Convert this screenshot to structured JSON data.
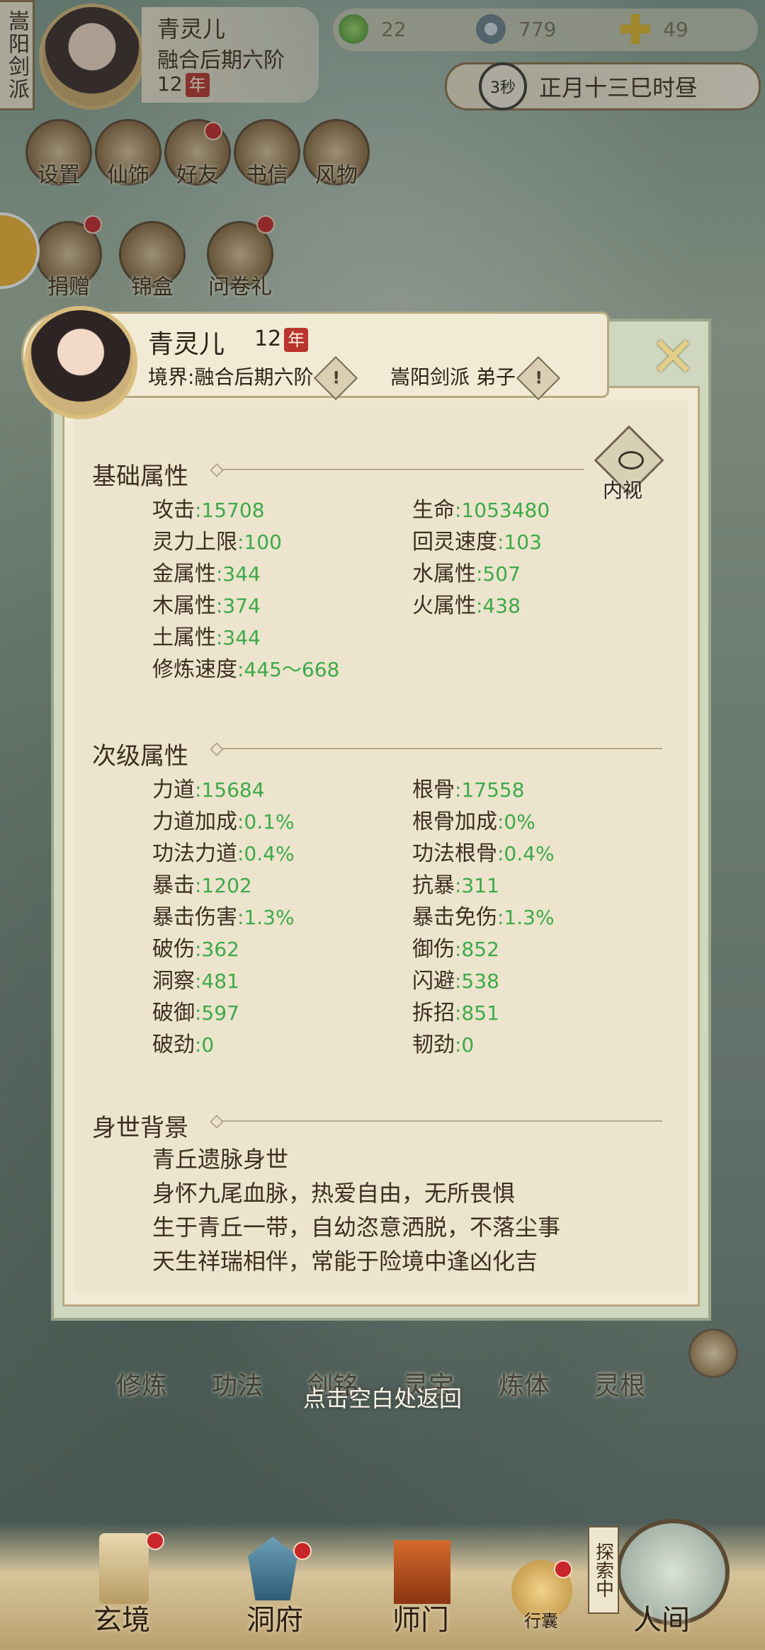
{
  "hud": {
    "sect": "嵩阳剑派",
    "player_name": "青灵儿",
    "realm": "融合后期六阶",
    "age": "12",
    "age_badge": "年",
    "resources": [
      {
        "icon": "jade-leaf-icon",
        "value": "22"
      },
      {
        "icon": "coin-icon",
        "value": "779"
      },
      {
        "icon": "gold-cross-icon",
        "value": "49"
      }
    ],
    "timer": "3秒",
    "game_time": "正月十三巳时昼"
  },
  "menu_row1": [
    {
      "label": "设置",
      "name": "settings",
      "dot": false
    },
    {
      "label": "仙饰",
      "name": "costume",
      "dot": false
    },
    {
      "label": "好友",
      "name": "friends",
      "dot": true
    },
    {
      "label": "书信",
      "name": "letters",
      "dot": false
    },
    {
      "label": "风物",
      "name": "scenery",
      "dot": false
    }
  ],
  "menu_row2": [
    {
      "label": "捐赠",
      "name": "donate",
      "dot": true
    },
    {
      "label": "锦盒",
      "name": "gift-box",
      "dot": false
    },
    {
      "label": "问卷礼",
      "name": "survey-gift",
      "dot": true
    }
  ],
  "panel": {
    "name": "青灵儿",
    "age": "12",
    "age_badge": "年",
    "realm_label": "境界",
    "realm_value": ":融合后期六阶",
    "sect_value": "嵩阳剑派 弟子",
    "warn_glyph": "!",
    "close_glyph": "✕",
    "inner_view_label": "内视",
    "basic_title": "基础属性",
    "basic_stats": [
      {
        "label": "攻击",
        "value": ":15708"
      },
      {
        "label": "生命",
        "value": ":1053480"
      },
      {
        "label": "灵力上限",
        "value": ":100"
      },
      {
        "label": "回灵速度",
        "value": ":103"
      },
      {
        "label": "金属性",
        "value": ":344"
      },
      {
        "label": "水属性",
        "value": ":507"
      },
      {
        "label": "木属性",
        "value": ":374"
      },
      {
        "label": "火属性",
        "value": ":438"
      },
      {
        "label": "土属性",
        "value": ":344"
      },
      {
        "label": "",
        "value": ""
      },
      {
        "label": "修炼速度",
        "value": ":445～668"
      }
    ],
    "secondary_title": "次级属性",
    "secondary_stats": [
      {
        "label": "力道",
        "value": ":15684"
      },
      {
        "label": "根骨",
        "value": ":17558"
      },
      {
        "label": "力道加成",
        "value": ":0.1%"
      },
      {
        "label": "根骨加成",
        "value": ":0%"
      },
      {
        "label": "功法力道",
        "value": ":0.4%"
      },
      {
        "label": "功法根骨",
        "value": ":0.4%"
      },
      {
        "label": "暴击",
        "value": ":1202"
      },
      {
        "label": "抗暴",
        "value": ":311"
      },
      {
        "label": "暴击伤害",
        "value": ":1.3%"
      },
      {
        "label": "暴击免伤",
        "value": ":1.3%"
      },
      {
        "label": "破伤",
        "value": ":362"
      },
      {
        "label": "御伤",
        "value": ":852"
      },
      {
        "label": "洞察",
        "value": ":481"
      },
      {
        "label": "闪避",
        "value": ":538"
      },
      {
        "label": "破御",
        "value": ":597"
      },
      {
        "label": "拆招",
        "value": ":851"
      },
      {
        "label": "破劲",
        "value": ":0"
      },
      {
        "label": "韧劲",
        "value": ":0"
      }
    ],
    "background_title": "身世背景",
    "background_lines": [
      "青丘遗脉身世",
      "身怀九尾血脉，热爱自由，无所畏惧",
      "生于青丘一带，自幼恣意洒脱，不落尘事",
      "天生祥瑞相伴，常能于险境中逢凶化吉"
    ]
  },
  "behind_menu": [
    "修炼",
    "功法",
    "剑铭",
    "灵宝",
    "炼体",
    "灵根"
  ],
  "hint": "点击空白处返回",
  "bottom_nav": [
    {
      "label": "玄境",
      "name": "xuanjing",
      "dot": true
    },
    {
      "label": "洞府",
      "name": "dongfu",
      "dot": true
    },
    {
      "label": "师门",
      "name": "shimen",
      "dot": false
    },
    {
      "label": "行囊",
      "name": "bag",
      "dot": true
    },
    {
      "label": "人间",
      "name": "renjian",
      "dot": false
    }
  ],
  "explore_tag": "探索中"
}
